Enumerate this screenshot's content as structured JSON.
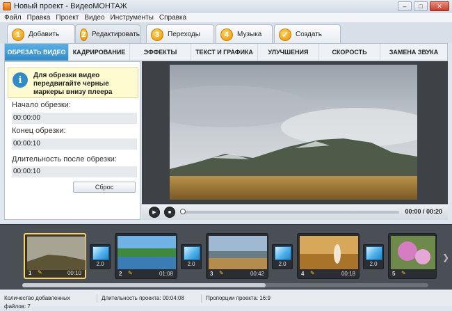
{
  "window": {
    "title": "Новый проект - ВидеоМОНТАЖ",
    "controls": [
      "–",
      "□",
      "✕"
    ]
  },
  "menu": [
    "Файл",
    "Правка",
    "Проект",
    "Видео",
    "Инструменты",
    "Справка"
  ],
  "steps": [
    {
      "num": "1",
      "label": "Добавить"
    },
    {
      "num": "2",
      "label": "Редактировать"
    },
    {
      "num": "3",
      "label": "Переходы"
    },
    {
      "num": "4",
      "label": "Музыка"
    },
    {
      "num": "✓",
      "label": "Создать"
    }
  ],
  "tabs": [
    "ОБРЕЗАТЬ ВИДЕО",
    "КАДРИРОВАНИЕ",
    "ЭФФЕКТЫ",
    "ТЕКСТ И ГРАФИКА",
    "УЛУЧШЕНИЯ",
    "СКОРОСТЬ",
    "ЗАМЕНА ЗВУКА"
  ],
  "trim": {
    "hint": "Для обрезки видео передвигайте черные маркеры внизу плеера",
    "start_label": "Начало обрезки:",
    "start_value": "00:00:00",
    "end_label": "Конец обрезки:",
    "end_value": "00:00:10",
    "duration_label": "Длительность после обрезки:",
    "duration_value": "00:00:10",
    "reset_label": "Сброс"
  },
  "player": {
    "time": "00:00 / 00:20",
    "progress": 0.0,
    "play_icon": "▶",
    "stop_icon": "■"
  },
  "clips": [
    {
      "num": "1",
      "duration": "00:10"
    },
    {
      "num": "2",
      "duration": "01:08"
    },
    {
      "num": "3",
      "duration": "00:42"
    },
    {
      "num": "4",
      "duration": "00:18"
    },
    {
      "num": "5",
      "duration": "00:19"
    }
  ],
  "transitions": [
    "2.0",
    "2.0",
    "2.0",
    "2.0"
  ],
  "status": {
    "files": "Количество добавленных файлов: 7",
    "duration": "Длительность проекта: 00:04:08",
    "ratio": "Пропорции проекта: 16:9"
  },
  "colors": {
    "accent": "#2f8bca",
    "step_badge": "#f4a312",
    "hint_bg": "#fffbd0"
  }
}
